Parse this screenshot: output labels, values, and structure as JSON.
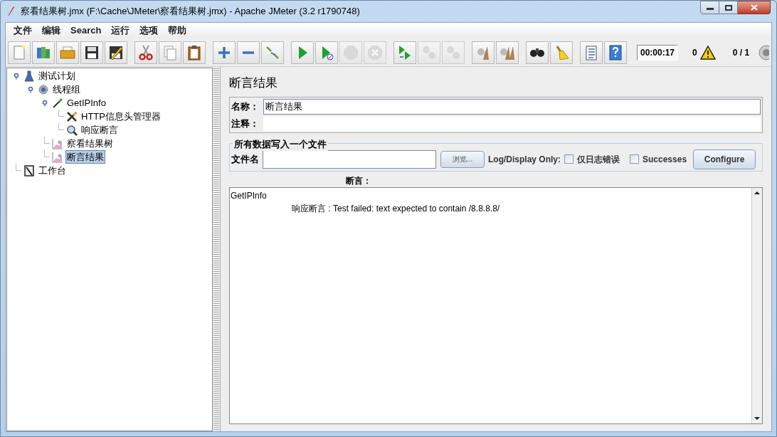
{
  "window": {
    "title": "察看结果树.jmx (F:\\Cache\\JMeter\\察看结果树.jmx) - Apache JMeter (3.2 r1790748)"
  },
  "menu": [
    "文件",
    "编辑",
    "Search",
    "运行",
    "选项",
    "帮助"
  ],
  "toolbar": [
    [
      {
        "kind": "new",
        "disabled": false
      },
      {
        "kind": "templates",
        "disabled": false
      },
      {
        "kind": "open",
        "disabled": false
      },
      {
        "kind": "save",
        "disabled": false
      },
      {
        "kind": "save-as",
        "disabled": false
      }
    ],
    [
      {
        "kind": "cut",
        "disabled": false
      },
      {
        "kind": "copy",
        "disabled": false
      },
      {
        "kind": "paste",
        "disabled": false
      }
    ],
    [
      {
        "kind": "expand",
        "disabled": false
      },
      {
        "kind": "collapse",
        "disabled": false
      },
      {
        "kind": "toggle",
        "disabled": false
      }
    ],
    [
      {
        "kind": "start",
        "disabled": false
      },
      {
        "kind": "start-no-pause",
        "disabled": false
      },
      {
        "kind": "stop",
        "disabled": true
      },
      {
        "kind": "shutdown",
        "disabled": true
      }
    ],
    [
      {
        "kind": "remote-start",
        "disabled": false
      },
      {
        "kind": "remote-stop",
        "disabled": true
      },
      {
        "kind": "remote-exit",
        "disabled": true
      }
    ],
    [
      {
        "kind": "clear",
        "disabled": false
      },
      {
        "kind": "clear-all",
        "disabled": false
      }
    ],
    [
      {
        "kind": "search",
        "disabled": false
      },
      {
        "kind": "reset-search",
        "disabled": false
      }
    ],
    [
      {
        "kind": "function",
        "disabled": false
      },
      {
        "kind": "help",
        "disabled": false
      }
    ]
  ],
  "status": {
    "timer": "00:00:17",
    "errors": "0",
    "threads": "0 / 1"
  },
  "tree": [
    {
      "label": "测试计划",
      "kind": "plan",
      "selected": false,
      "children": [
        {
          "label": "线程组",
          "kind": "threads",
          "selected": false,
          "children": [
            {
              "label": "GetIPInfo",
              "kind": "sampler",
              "selected": false,
              "children": [
                {
                  "label": "HTTP信息头管理器",
                  "kind": "config",
                  "selected": false
                },
                {
                  "label": "响应断言",
                  "kind": "assertion",
                  "selected": false
                }
              ]
            },
            {
              "label": "察看结果树",
              "kind": "listener",
              "selected": false
            },
            {
              "label": "断言结果",
              "kind": "listener",
              "selected": true
            }
          ]
        }
      ]
    },
    {
      "label": "工作台",
      "kind": "workbench",
      "selected": false
    }
  ],
  "panel": {
    "title": "断言结果",
    "name_label": "名称：",
    "name_value": "断言结果",
    "comment_label": "注释：",
    "file_group": {
      "legend": "所有数据写入一个文件",
      "file_label": "文件名",
      "browse": "浏览...",
      "log_only_label": "Log/Display Only:",
      "options": [
        {
          "label": "仅日志错误",
          "checked": false
        },
        {
          "label": "Successes",
          "checked": false
        }
      ],
      "configure": "Configure"
    },
    "results_label": "断言：",
    "results": [
      {
        "sampler": "GetIPInfo",
        "messages": [
          "响应断言 : Test failed: text expected to contain /8.8.8.8/"
        ]
      }
    ]
  }
}
